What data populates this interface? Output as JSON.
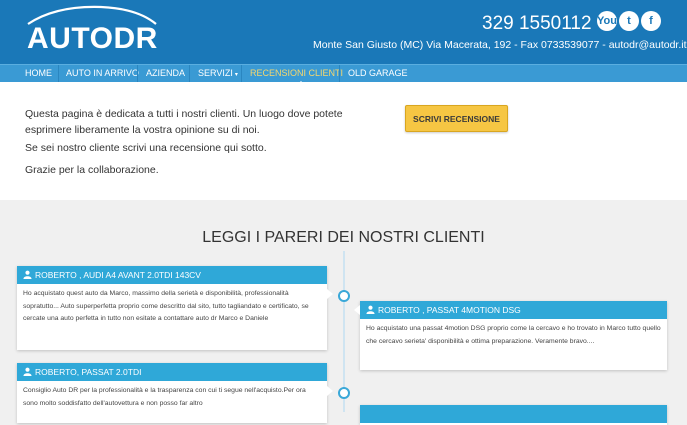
{
  "header": {
    "logo_text": "AUTODR",
    "phone": "329 1550112",
    "address": "Monte San Giusto (MC) Via Macerata, 192 - Fax 0733539077 - autodr@autodr.it",
    "social": [
      {
        "icon": "youtube-icon",
        "label": "You"
      },
      {
        "icon": "twitter-icon",
        "label": "t"
      },
      {
        "icon": "facebook-icon",
        "label": "f"
      }
    ]
  },
  "nav": {
    "items": [
      "HOME",
      "AUTO IN ARRIVO",
      "AZIENDA",
      "SERVIZI",
      "RECENSIONI CLIENTI",
      "OLD GARAGE"
    ],
    "active": "RECENSIONI CLIENTI"
  },
  "intro": {
    "p1": "Questa pagina è dedicata a tutti i nostri clienti. Un luogo dove potete esprimere liberamente la vostra opinione su di noi.",
    "p2": "Se sei nostro cliente scrivi una recensione qui sotto.",
    "p3": "Grazie per la collaborazione.",
    "button": "SCRIVI RECENSIONE"
  },
  "reviews": {
    "title": "LEGGI I PARERI DEI NOSTRI CLIENTI",
    "items": [
      {
        "author": "ROBERTO , AUDI A4 AVANT 2.0TDI 143CV",
        "text": "Ho acquistato quest auto da Marco, massimo della serietà e disponibilità, professionalità sopratutto... Auto superperfetta proprio come descritto dal sito, tutto tagliandato e certificato, se cercate una auto perfetta in tutto non esitate a contattare auto dr Marco e Daniele"
      },
      {
        "author": "ROBERTO , PASSAT 4MOTION DSG",
        "text": "Ho acquistato una passat 4motion DSG proprio come la cercavo e ho trovato in Marco tutto quello che cercavo serieta' disponibilità e ottima preparazione. Veramente bravo...."
      },
      {
        "author": "ROBERTO, PASSAT 2.0TDI",
        "text": "Consiglio Auto DR per la professionalità e la trasparenza con cui ti segue nell'acquisto.Per ora sono molto soddisfatto dell'autovettura e non posso far altro"
      }
    ]
  },
  "colors": {
    "header_bg": "#1a78b8",
    "nav_bg": "#3a9ad4",
    "nav_active": "#f5d76e",
    "card_head": "#2fa8d8",
    "button": "#f6c643"
  }
}
